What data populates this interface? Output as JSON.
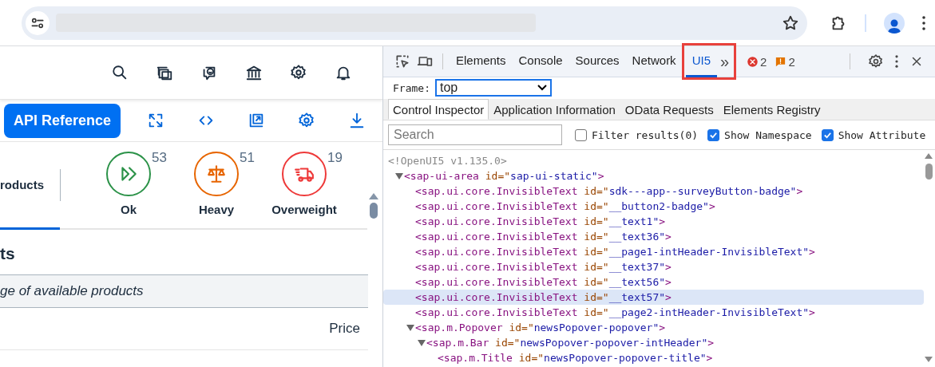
{
  "page": {
    "toolbar": {
      "button": "API Reference"
    },
    "icon_tabs": [
      {
        "kind": "text",
        "label": "roducts",
        "selected": true
      },
      {
        "kind": "forward",
        "label": "Ok",
        "count": "53",
        "color": "#2b9248",
        "selected": false
      },
      {
        "kind": "scale",
        "label": "Heavy",
        "count": "51",
        "color": "#e76500",
        "selected": false
      },
      {
        "kind": "truck",
        "label": "Overweight",
        "count": "19",
        "color": "#ee3939",
        "selected": false
      }
    ],
    "title": "ts",
    "info": "ge of available products",
    "table": {
      "columns": [
        "Price"
      ]
    }
  },
  "devtools": {
    "tabs": [
      {
        "label": "Elements",
        "selected": false,
        "highlighted": false
      },
      {
        "label": "Console",
        "selected": false,
        "highlighted": false
      },
      {
        "label": "Sources",
        "selected": false,
        "highlighted": false
      },
      {
        "label": "Network",
        "selected": false,
        "highlighted": false
      },
      {
        "label": "UI5",
        "selected": true,
        "highlighted": true
      }
    ],
    "overflow": "»",
    "errors": "2",
    "warnings": "2",
    "frame": {
      "label": "Frame:",
      "value": "top"
    },
    "subtabs": [
      {
        "label": "Control Inspector",
        "selected": true
      },
      {
        "label": "Application Information",
        "selected": false
      },
      {
        "label": "OData Requests",
        "selected": false
      },
      {
        "label": "Elements Registry",
        "selected": false
      }
    ],
    "search": {
      "placeholder": "Search"
    },
    "filters": [
      {
        "label": "Filter results(0)",
        "checked": false
      },
      {
        "label": "Show Namespace",
        "checked": true
      },
      {
        "label": "Show Attribute",
        "checked": true
      }
    ],
    "comment": "<!OpenUI5 v1.135.0>",
    "tree": [
      {
        "tag": "<sap-ui-area",
        "attr": " id=\"",
        "value": "sap-ui-static\"",
        "end": ">",
        "selected": false,
        "expanded": true,
        "children": [
          {
            "tag": "<sap.ui.core.InvisibleText",
            "attr": " id=\"",
            "value": "sdk---app--surveyButton-badge\"",
            "end": ">",
            "selected": false
          },
          {
            "tag": "<sap.ui.core.InvisibleText",
            "attr": " id=\"",
            "value": "__button2-badge\"",
            "end": ">",
            "selected": false
          },
          {
            "tag": "<sap.ui.core.InvisibleText",
            "attr": " id=\"",
            "value": "__text1\"",
            "end": ">",
            "selected": false
          },
          {
            "tag": "<sap.ui.core.InvisibleText",
            "attr": " id=\"",
            "value": "__text36\"",
            "end": ">",
            "selected": false
          },
          {
            "tag": "<sap.ui.core.InvisibleText",
            "attr": " id=\"",
            "value": "__page1-intHeader-InvisibleText\"",
            "end": ">",
            "selected": false
          },
          {
            "tag": "<sap.ui.core.InvisibleText",
            "attr": " id=\"",
            "value": "__text37\"",
            "end": ">",
            "selected": false
          },
          {
            "tag": "<sap.ui.core.InvisibleText",
            "attr": " id=\"",
            "value": "__text56\"",
            "end": ">",
            "selected": false
          },
          {
            "tag": "<sap.ui.core.InvisibleText",
            "attr": " id=\"",
            "value": "__text57\"",
            "end": ">",
            "selected": true
          },
          {
            "tag": "<sap.ui.core.InvisibleText",
            "attr": " id=\"",
            "value": "__page2-intHeader-InvisibleText\"",
            "end": ">",
            "selected": false
          },
          {
            "tag": "<sap.m.Popover",
            "attr": " id=\"",
            "value": "newsPopover-popover\"",
            "end": ">",
            "selected": false,
            "expanded": true,
            "children": [
              {
                "tag": "<sap.m.Bar",
                "attr": " id=\"",
                "value": "newsPopover-popover-intHeader\"",
                "end": ">",
                "selected": false,
                "expanded": true,
                "children": [
                  {
                    "tag": "<sap.m.Title",
                    "attr": " id=\"",
                    "value": "newsPopover-popover-title\"",
                    "end": ">",
                    "selected": false
                  }
                ]
              }
            ]
          }
        ]
      }
    ]
  }
}
